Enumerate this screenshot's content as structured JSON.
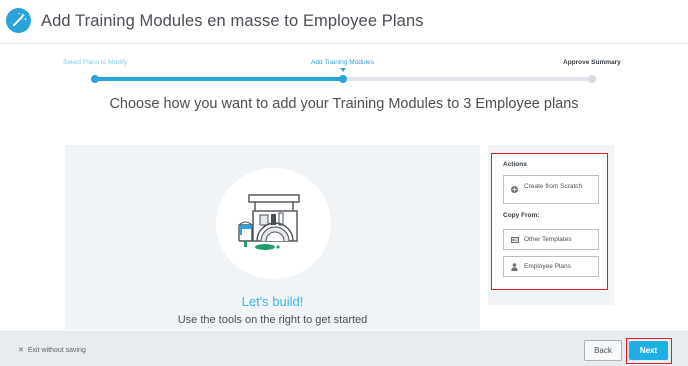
{
  "header": {
    "logo_icon": "magic-wand-icon",
    "title": "Add Training Modules en masse to Employee Plans"
  },
  "stepper": {
    "steps": [
      {
        "label": "Select Plans to Modify",
        "state": "completed"
      },
      {
        "label": "Add Training Modules",
        "state": "current"
      },
      {
        "label": "Approve Summary",
        "state": "upcoming"
      }
    ],
    "progress": 0.5
  },
  "main": {
    "headline": "Choose how you want to add your Training Modules to 3 Employee plans",
    "empty_state": {
      "illustration": "toolbox-paint-illustration",
      "title": "Let's build!",
      "subtitle": "Use the tools on the right to get started"
    }
  },
  "actions": {
    "heading": "Actions",
    "create_from_scratch": {
      "label": "Create from Scratch",
      "icon": "plus-circle-icon"
    },
    "copy_heading": "Copy From:",
    "other_templates": {
      "label": "Other Templates",
      "icon": "id-card-icon"
    },
    "employee_plans": {
      "label": "Employee Plans",
      "icon": "person-icon"
    }
  },
  "footer": {
    "exit_label": "Exit without saving",
    "exit_icon": "close-icon",
    "back_label": "Back",
    "next_label": "Next"
  },
  "colors": {
    "accent": "#1fb0e3",
    "highlight_border": "#e02020",
    "text": "#4a4f55"
  }
}
